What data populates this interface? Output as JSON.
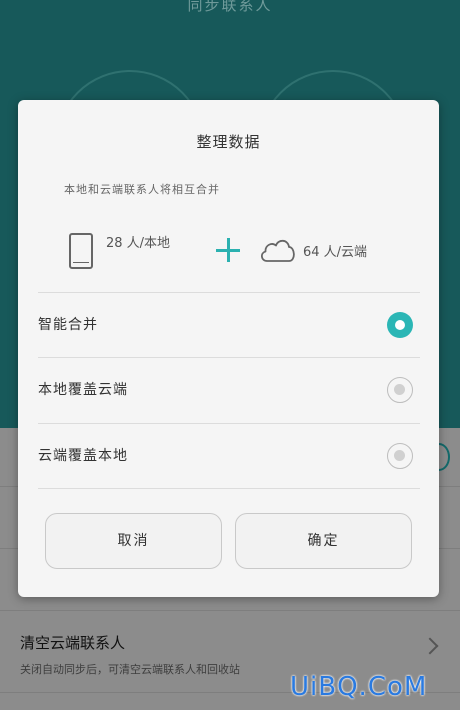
{
  "background": {
    "title": "同步联系人",
    "clear_item": {
      "title": "清空云端联系人",
      "subtitle": "关闭自动同步后，可清空云端联系人和回收站"
    },
    "watermark": "UiBQ.CoM"
  },
  "dialog": {
    "title": "整理数据",
    "description": "本地和云端联系人将相互合并",
    "local": {
      "icon": "phone-icon",
      "count_label": "28 人/本地"
    },
    "plus": {
      "icon": "plus-icon"
    },
    "cloud": {
      "icon": "cloud-icon",
      "count_label": "64 人/云端"
    },
    "options": [
      {
        "label": "智能合并",
        "selected": true
      },
      {
        "label": "本地覆盖云端",
        "selected": false
      },
      {
        "label": "云端覆盖本地",
        "selected": false
      }
    ],
    "buttons": {
      "cancel": "取消",
      "confirm": "确定"
    }
  },
  "colors": {
    "accent": "#2bb6b5",
    "header_bg": "#17595a"
  }
}
